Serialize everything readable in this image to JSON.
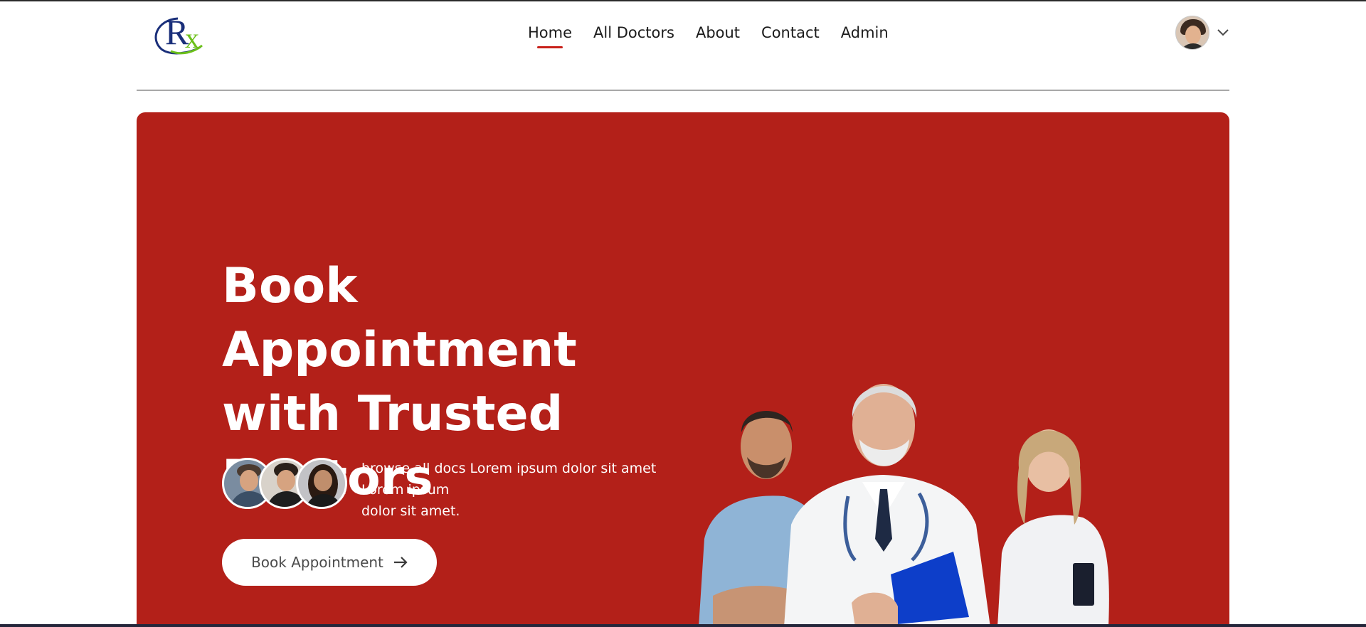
{
  "logo": {
    "r": "R",
    "x": "x"
  },
  "nav": {
    "items": [
      {
        "label": "Home",
        "active": true
      },
      {
        "label": "All Doctors",
        "active": false
      },
      {
        "label": "About",
        "active": false
      },
      {
        "label": "Contact",
        "active": false
      },
      {
        "label": "Admin",
        "active": false
      }
    ]
  },
  "profile": {
    "avatar_icon": "user-avatar",
    "dropdown_icon": "chevron-down-icon"
  },
  "hero": {
    "title_line1": "Book Appointment",
    "title_line2": "with Trusted",
    "title_line3": "Doctors",
    "subtext_line1": "browse all docs Lorem ipsum dolor sit amet Lorem ipsum",
    "subtext_line2": "dolor sit amet.",
    "cta_label": "Book Appointment",
    "cta_icon": "arrow-right-icon"
  },
  "colors": {
    "hero_bg": "#b32019",
    "active_underline": "#c8211a",
    "logo_blue": "#1a2f7a",
    "logo_green": "#6cc01a"
  }
}
